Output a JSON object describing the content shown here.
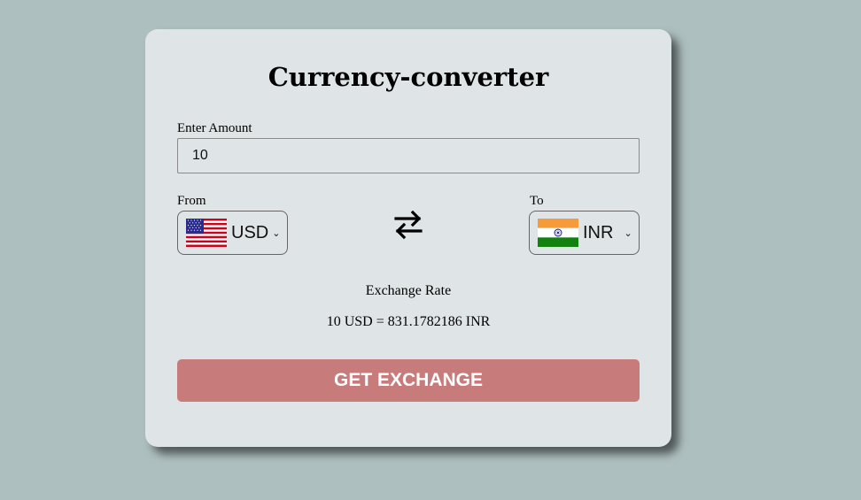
{
  "app": {
    "title": "Currency-converter"
  },
  "amount": {
    "label": "Enter Amount",
    "value": "10"
  },
  "from": {
    "label": "From",
    "currency": "USD",
    "flag_icon": "us-flag-icon"
  },
  "to": {
    "label": "To",
    "currency": "INR",
    "flag_icon": "india-flag-icon"
  },
  "swap": {
    "icon": "swap-arrows-icon"
  },
  "exchange": {
    "label": "Exchange Rate",
    "result": "10 USD = 831.1782186 INR"
  },
  "button": {
    "label": "GET EXCHANGE"
  },
  "colors": {
    "background": "#aebfbf",
    "card": "#dfe4e6",
    "button": "#c77b7b",
    "button_text": "#ffffff"
  }
}
